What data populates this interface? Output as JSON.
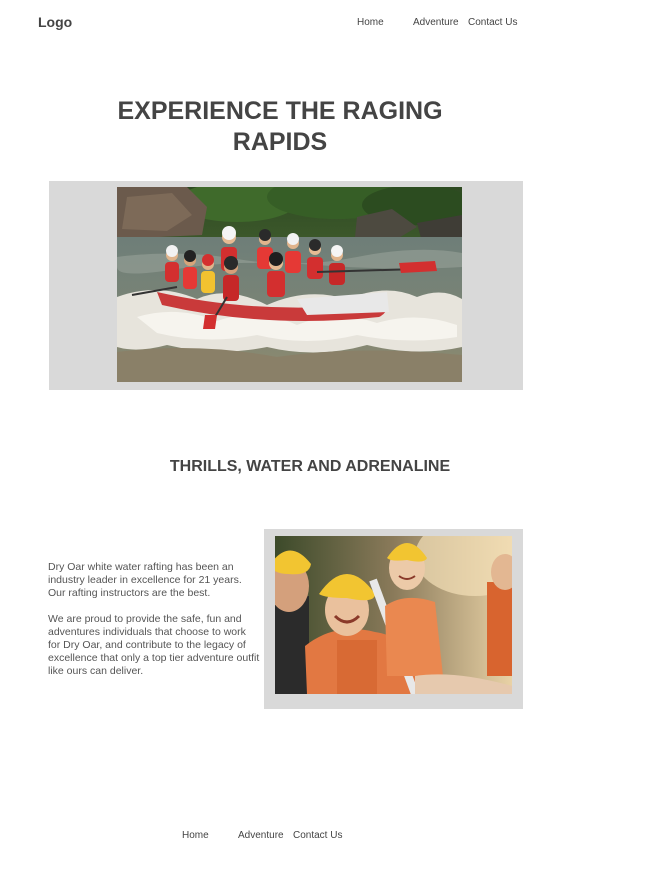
{
  "header": {
    "logo": "Logo",
    "nav": [
      {
        "label": "Home"
      },
      {
        "label": "Adventure"
      },
      {
        "label": "Contact Us"
      }
    ]
  },
  "hero": {
    "title": "EXPERIENCE THE RAGING RAPIDS",
    "image_alt": "Group white water rafting"
  },
  "section": {
    "heading": "THRILLS, WATER AND ADRENALINE",
    "paragraph_1": "Dry Oar white water rafting has been an industry leader in excellence for 21 years. Our rafting instructors are the best.",
    "paragraph_2": "We are proud to provide the safe, fun and adventures individuals that choose to work for Dry Oar, and contribute to the legacy of excellence that only a top tier adventure outfit like ours can deliver.",
    "image_alt": "Smiling rafters in helmets"
  },
  "footer": {
    "nav": [
      {
        "label": "Home"
      },
      {
        "label": "Adventure"
      },
      {
        "label": "Contact Us"
      }
    ]
  }
}
